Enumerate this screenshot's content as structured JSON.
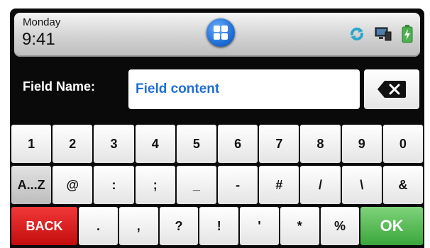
{
  "status": {
    "day": "Monday",
    "time": "9:41",
    "icons": [
      "home-icon",
      "sync-icon",
      "monitor-icon",
      "battery-icon"
    ],
    "colors": {
      "home": "#1f6fd6",
      "sync": "#2aa7c9",
      "battery": "#4caf50"
    }
  },
  "field": {
    "label": "Field Name:",
    "value": "Field content",
    "delete_icon": "backspace-icon"
  },
  "keyboard": {
    "row1": [
      "1",
      "2",
      "3",
      "4",
      "5",
      "6",
      "7",
      "8",
      "9",
      "0"
    ],
    "row2": [
      "A...Z",
      "@",
      ":",
      ";",
      "_",
      "-",
      "#",
      "/",
      "\\",
      "&"
    ],
    "row3": [
      "BACK",
      ".",
      ",",
      "?",
      "!",
      "'",
      "*",
      "%",
      "OK"
    ]
  },
  "colors": {
    "accent": "#1f6fd6",
    "back": "#e02020",
    "ok": "#4caf50"
  }
}
